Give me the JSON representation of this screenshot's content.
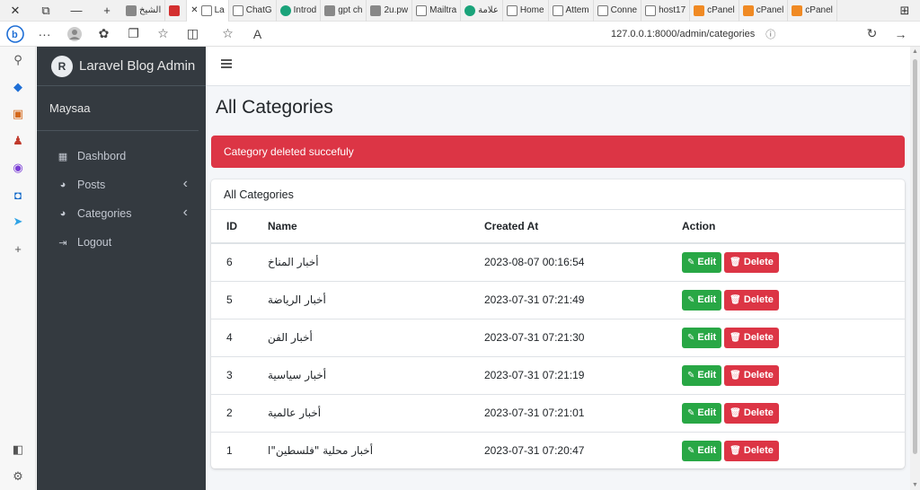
{
  "browser": {
    "tabs": [
      {
        "label": "الشيخ",
        "icon": "gray"
      },
      {
        "label": "",
        "icon": "red"
      },
      {
        "label": "La",
        "icon": "doc",
        "active": true
      },
      {
        "label": "ChatG",
        "icon": "doc"
      },
      {
        "label": "Introd",
        "icon": "teal"
      },
      {
        "label": "gpt ch",
        "icon": "gray"
      },
      {
        "label": "2u.pw",
        "icon": "gray"
      },
      {
        "label": "Mailtra",
        "icon": "doc"
      },
      {
        "label": "علامة",
        "icon": "teal"
      },
      {
        "label": "Home",
        "icon": "doc"
      },
      {
        "label": "Attem",
        "icon": "doc"
      },
      {
        "label": "Conne",
        "icon": "doc"
      },
      {
        "label": "host17",
        "icon": "doc"
      },
      {
        "label": "cPanel",
        "icon": "orange"
      },
      {
        "label": "cPanel",
        "icon": "orange"
      },
      {
        "label": "cPanel",
        "icon": "orange"
      }
    ],
    "url": "127.0.0.1:8000/admin/categories"
  },
  "sidebar": {
    "brand": "Laravel Blog Admin",
    "brand_logo": "R",
    "user": "Maysaa",
    "items": [
      {
        "label": "Dashbord",
        "icon": "grid-icon",
        "has_children": false
      },
      {
        "label": "Posts",
        "icon": "palette-icon",
        "has_children": true
      },
      {
        "label": "Categories",
        "icon": "palette-icon",
        "has_children": true
      },
      {
        "label": "Logout",
        "icon": "logout-icon",
        "has_children": false
      }
    ]
  },
  "main": {
    "title": "All Categories",
    "alert": "Category deleted succefuly",
    "card_title": "All Categories",
    "columns": [
      "ID",
      "Name",
      "Created At",
      "Action"
    ],
    "rows": [
      {
        "id": "6",
        "name": "أخبار المناخ",
        "created_at": "2023-08-07 00:16:54"
      },
      {
        "id": "5",
        "name": "أخبار الرياضة",
        "created_at": "2023-07-31 07:21:49"
      },
      {
        "id": "4",
        "name": "أخبار الفن",
        "created_at": "2023-07-31 07:21:30"
      },
      {
        "id": "3",
        "name": "أخبار سياسية",
        "created_at": "2023-07-31 07:21:19"
      },
      {
        "id": "2",
        "name": "أخبار عالمية",
        "created_at": "2023-07-31 07:21:01"
      },
      {
        "id": "1",
        "name": "أخبار محلية \"فلسطين\"ا",
        "created_at": "2023-07-31 07:20:47"
      }
    ],
    "edit_label": "Edit",
    "delete_label": "Delete"
  },
  "colors": {
    "sidebar_bg": "#343a40",
    "alert_bg": "#dc3545",
    "edit_btn": "#28a745",
    "delete_btn": "#dc3545",
    "content_bg": "#f4f6f9"
  }
}
